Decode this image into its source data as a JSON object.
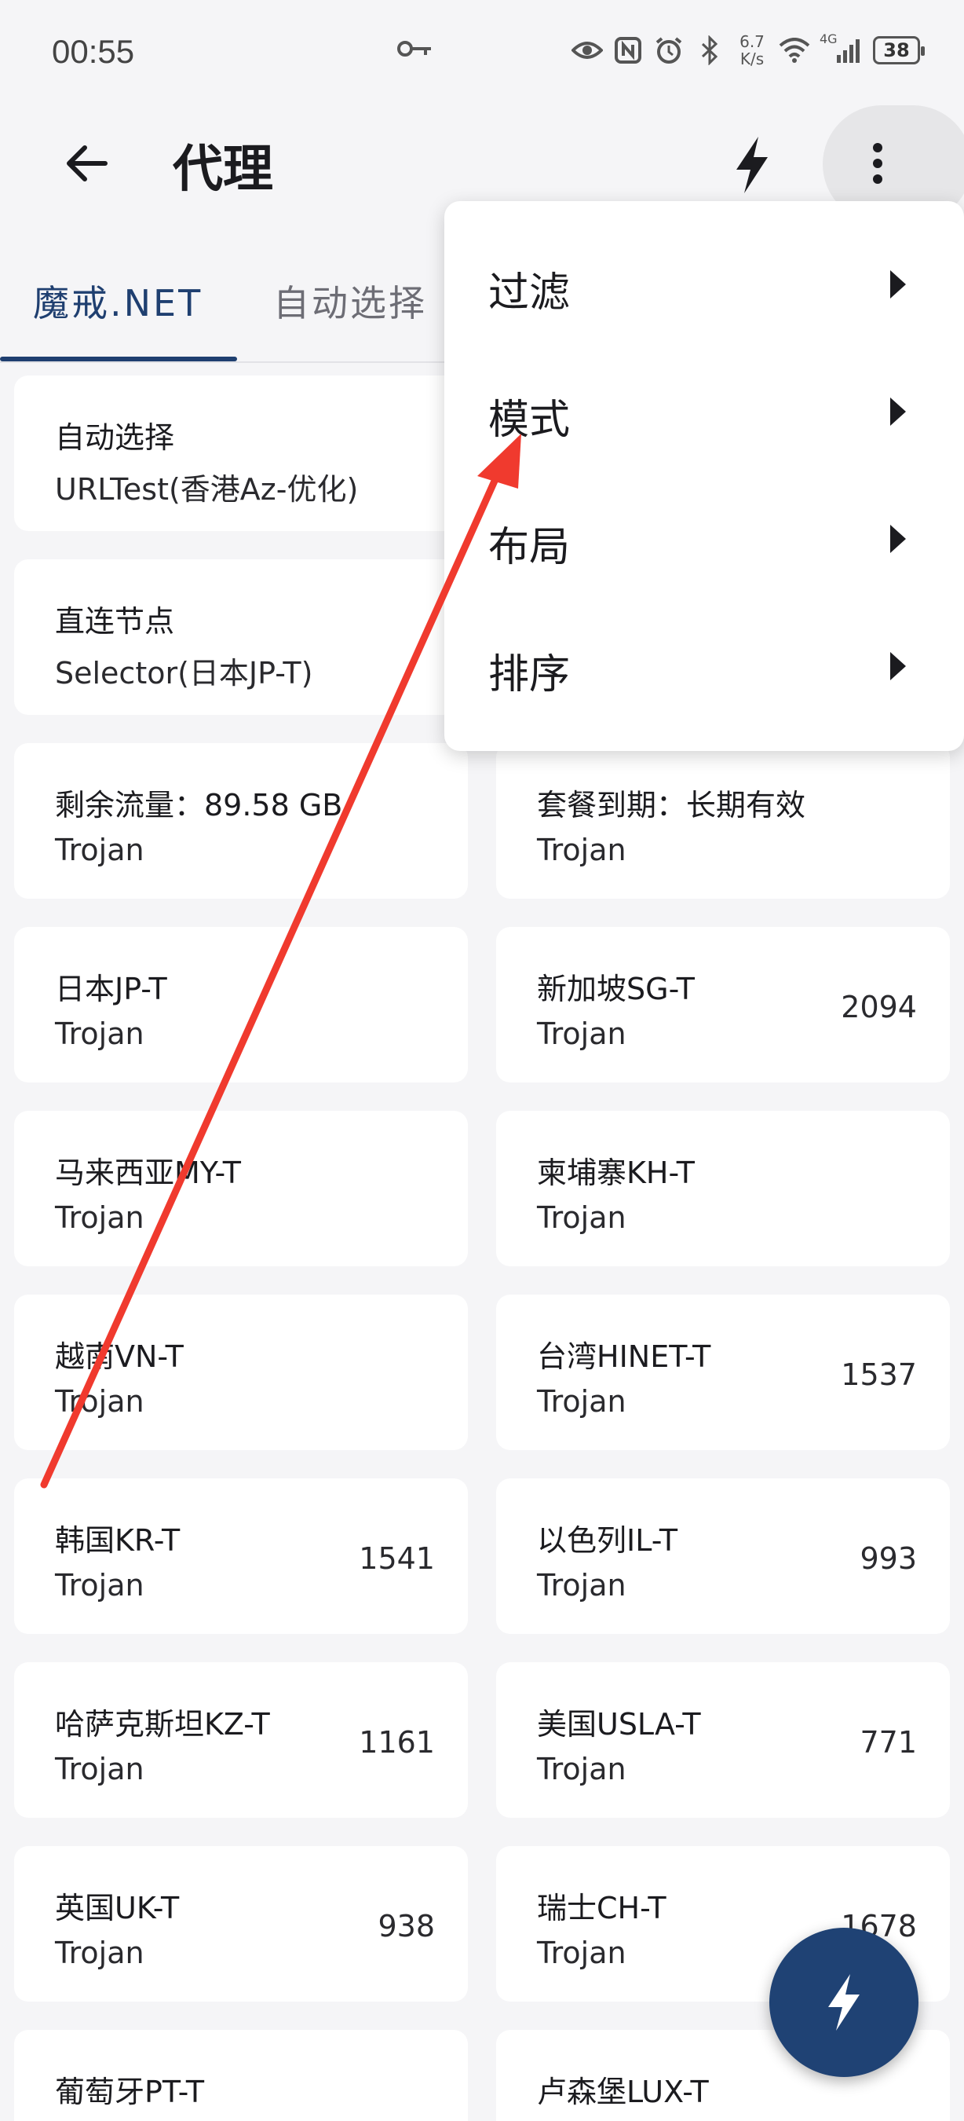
{
  "status_bar": {
    "time": "00:55",
    "net_speed_value": "6.7",
    "net_speed_unit": "K/s",
    "network_type": "4G",
    "battery": "38"
  },
  "toolbar": {
    "title": "代理",
    "icons": [
      "back-arrow-icon",
      "bolt-icon",
      "more-vert-icon"
    ]
  },
  "tabs": [
    {
      "label": "魔戒.NET",
      "active": true
    },
    {
      "label": "自动选择",
      "active": false
    }
  ],
  "proxies": [
    {
      "name": "自动选择",
      "type": "URLTest(香港Az-优化)",
      "delay": ""
    },
    {
      "name": "直连节点",
      "type": "Selector(日本JP-T)",
      "delay": ""
    },
    {
      "name": "剩余流量：89.58 GB",
      "type": "Trojan",
      "delay": ""
    },
    {
      "name": "套餐到期：长期有效",
      "type": "Trojan",
      "delay": ""
    },
    {
      "name": "日本JP-T",
      "type": "Trojan",
      "delay": ""
    },
    {
      "name": "新加坡SG-T",
      "type": "Trojan",
      "delay": "2094"
    },
    {
      "name": "马来西亚MY-T",
      "type": "Trojan",
      "delay": ""
    },
    {
      "name": "柬埔寨KH-T",
      "type": "Trojan",
      "delay": ""
    },
    {
      "name": "越南VN-T",
      "type": "Trojan",
      "delay": ""
    },
    {
      "name": "台湾HINET-T",
      "type": "Trojan",
      "delay": "1537"
    },
    {
      "name": "韩国KR-T",
      "type": "Trojan",
      "delay": "1541"
    },
    {
      "name": "以色列IL-T",
      "type": "Trojan",
      "delay": "993"
    },
    {
      "name": "哈萨克斯坦KZ-T",
      "type": "Trojan",
      "delay": "1161"
    },
    {
      "name": "美国USLA-T",
      "type": "Trojan",
      "delay": "771"
    },
    {
      "name": "英国UK-T",
      "type": "Trojan",
      "delay": "938"
    },
    {
      "name": "瑞士CH-T",
      "type": "Trojan",
      "delay": "1678"
    },
    {
      "name": "葡萄牙PT-T",
      "type": "",
      "delay": ""
    },
    {
      "name": "卢森堡LUX-T",
      "type": "",
      "delay": ""
    }
  ],
  "menu": {
    "items": [
      {
        "label": "过滤"
      },
      {
        "label": "模式"
      },
      {
        "label": "布局"
      },
      {
        "label": "排序"
      }
    ]
  },
  "colors": {
    "accent": "#1f3f70",
    "fab": "#1f4274",
    "annotation_arrow": "#f03a2e",
    "background": "#f5f5f7"
  }
}
